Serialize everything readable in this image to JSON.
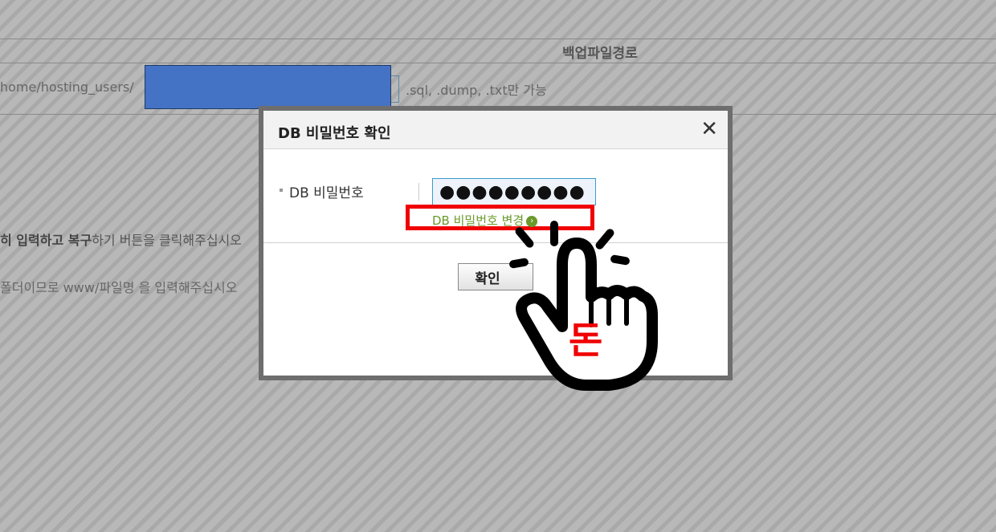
{
  "background": {
    "column_header": "백업파일경로",
    "path_prefix": "home/hosting_users/",
    "extensions_note": ".sql, .dump, .txt만 가능",
    "instruction_bold": "히 입력하고 복구",
    "instruction_rest": "하기 버튼을 클릭해주십시오",
    "instruction2": "폴더이므로 www/파일명 을 입력해주십시오"
  },
  "modal": {
    "title": "DB 비밀번호 확인",
    "close_symbol": "✕",
    "field_label": "DB 비밀번호",
    "password_mask": "●●●●●●●●●",
    "change_link": "DB 비밀번호 변경",
    "confirm_label": "확인"
  },
  "overlay": {
    "hand_caption": "돈",
    "highlight_color": "#f00000"
  }
}
